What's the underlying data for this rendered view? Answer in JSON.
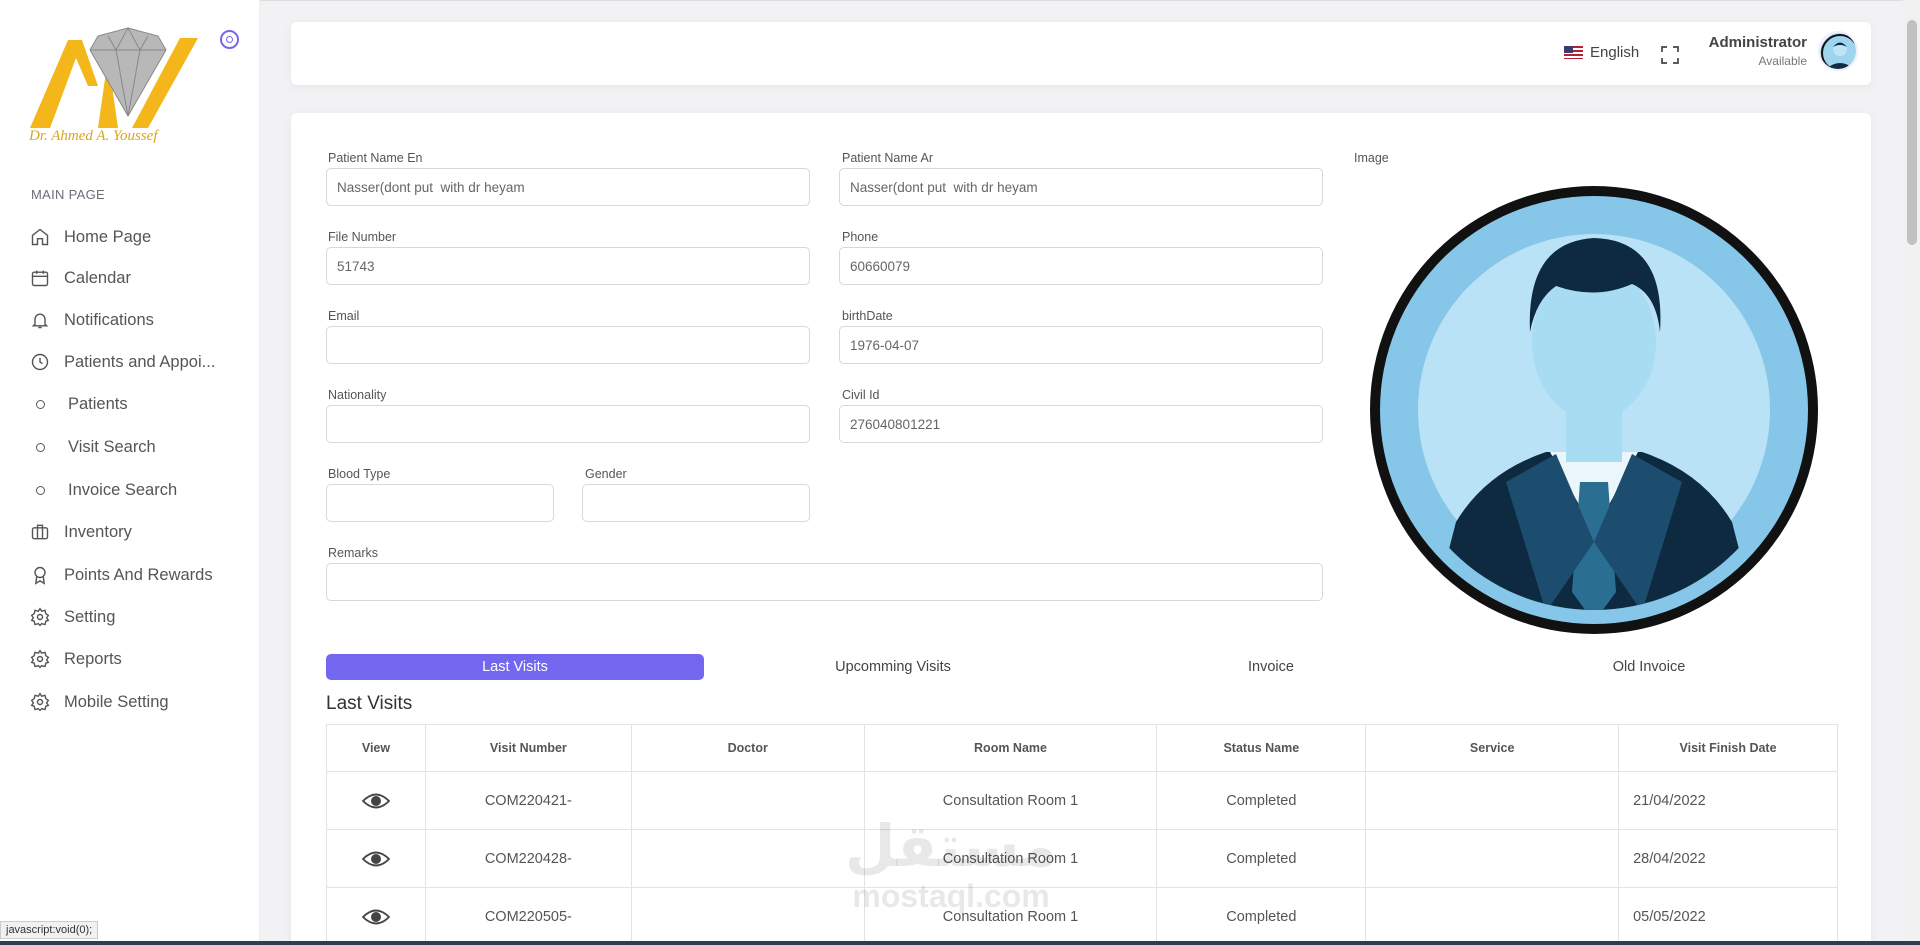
{
  "brand": {
    "logo_text": "AY",
    "subtitle": "Dr. Ahmed A. Youssef"
  },
  "sidebar": {
    "header": "MAIN PAGE",
    "items": [
      {
        "label": "Home Page",
        "icon": "home-icon"
      },
      {
        "label": "Calendar",
        "icon": "calendar-icon"
      },
      {
        "label": "Notifications",
        "icon": "bell-icon"
      },
      {
        "label": "Patients and Appoi...",
        "icon": "clock-icon"
      },
      {
        "label": "Patients",
        "icon": "circle-icon"
      },
      {
        "label": "Visit Search",
        "icon": "circle-icon"
      },
      {
        "label": "Invoice Search",
        "icon": "circle-icon"
      },
      {
        "label": "Inventory",
        "icon": "briefcase-icon"
      },
      {
        "label": "Points And Rewards",
        "icon": "award-icon"
      },
      {
        "label": "Setting",
        "icon": "gear-icon"
      },
      {
        "label": "Reports",
        "icon": "gear-icon"
      },
      {
        "label": "Mobile Setting",
        "icon": "gear-icon"
      }
    ]
  },
  "header": {
    "language": "English",
    "user_name": "Administrator",
    "user_status": "Available"
  },
  "form": {
    "patient_name_en": {
      "label": "Patient Name En",
      "value": "Nasser(dont put  with dr heyam"
    },
    "patient_name_ar": {
      "label": "Patient Name Ar",
      "value": "Nasser(dont put  with dr heyam"
    },
    "file_number": {
      "label": "File Number",
      "value": "51743"
    },
    "phone": {
      "label": "Phone",
      "value": "60660079"
    },
    "email": {
      "label": "Email",
      "value": ""
    },
    "birth_date": {
      "label": "birthDate",
      "value": "1976-04-07"
    },
    "nationality": {
      "label": "Nationality",
      "value": ""
    },
    "civil_id": {
      "label": "Civil Id",
      "value": "276040801221"
    },
    "blood_type": {
      "label": "Blood Type",
      "value": ""
    },
    "gender": {
      "label": "Gender",
      "value": ""
    },
    "remarks": {
      "label": "Remarks",
      "value": ""
    },
    "image_label": "Image"
  },
  "tabs": [
    {
      "label": "Last Visits",
      "active": true
    },
    {
      "label": "Upcomming Visits",
      "active": false
    },
    {
      "label": "Invoice",
      "active": false
    },
    {
      "label": "Old Invoice",
      "active": false
    }
  ],
  "visits": {
    "title": "Last Visits",
    "columns": [
      "View",
      "Visit Number",
      "Doctor",
      "Room Name",
      "Status Name",
      "Service",
      "Visit Finish Date"
    ],
    "rows": [
      {
        "visit_number": "COM220421-",
        "doctor": "",
        "room": "Consultation Room 1",
        "status": "Completed",
        "service": "",
        "finish_date": "21/04/2022"
      },
      {
        "visit_number": "COM220428-",
        "doctor": "",
        "room": "Consultation Room 1",
        "status": "Completed",
        "service": "",
        "finish_date": "28/04/2022"
      },
      {
        "visit_number": "COM220505-",
        "doctor": "",
        "room": "Consultation Room 1",
        "status": "Completed",
        "service": "",
        "finish_date": "05/05/2022"
      }
    ]
  },
  "watermark": {
    "line1": "مستقل",
    "line2": "mostaql.com"
  },
  "status_bar": "javascript:void(0);",
  "colors": {
    "accent": "#7367f0",
    "brand_gold": "#f3b71b"
  }
}
